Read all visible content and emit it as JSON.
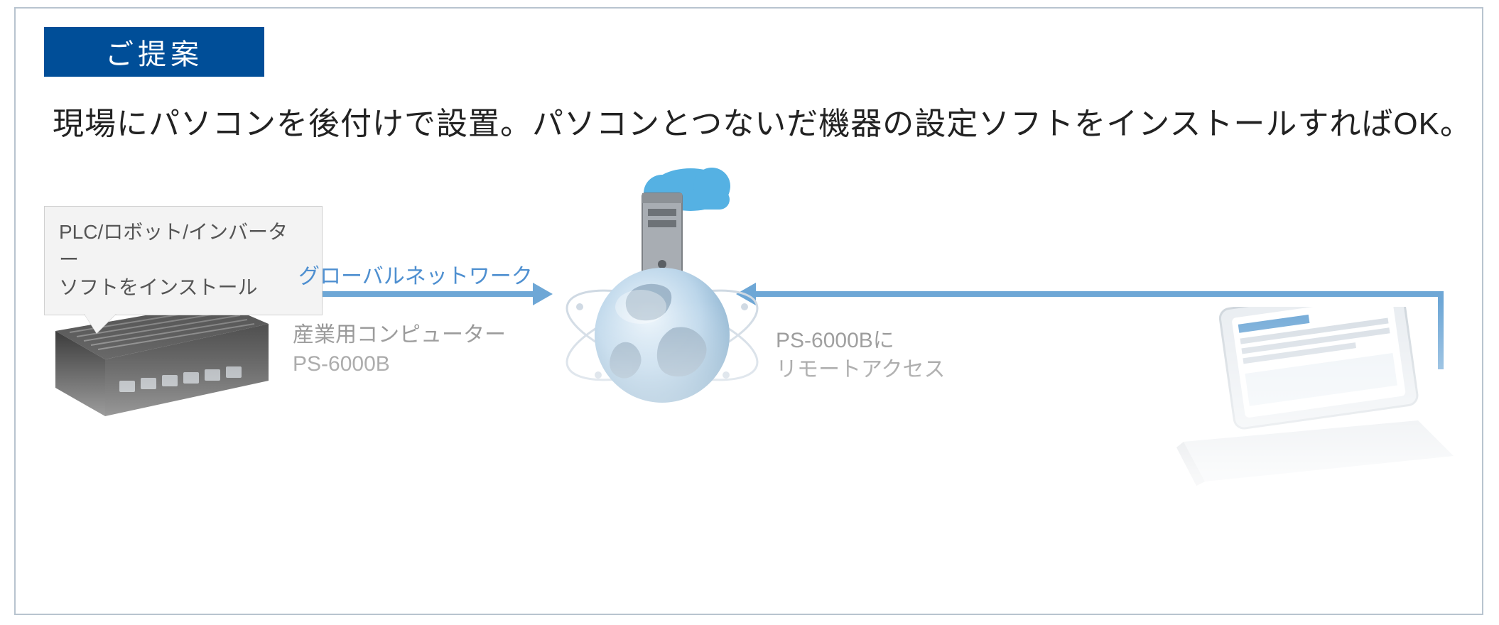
{
  "badge": {
    "label": "ご提案"
  },
  "headline": "現場にパソコンを後付けで設置。パソコンとつないだ機器の設定ソフトをインストールすればOK。",
  "callout": {
    "line1": "PLC/ロボット/インバーター",
    "line2": "ソフトをインストール"
  },
  "network_label": "グローバルネットワーク",
  "ipc_label": {
    "line1": "産業用コンピューター",
    "line2": "PS-6000B"
  },
  "right_label": {
    "line1": "PS-6000Bに",
    "line2": "リモートアクセス"
  },
  "colors": {
    "brand_blue": "#004e98",
    "line_blue": "#6ea7d6",
    "text_blue": "#4e8fd0",
    "cloud": "#55b1e3"
  }
}
